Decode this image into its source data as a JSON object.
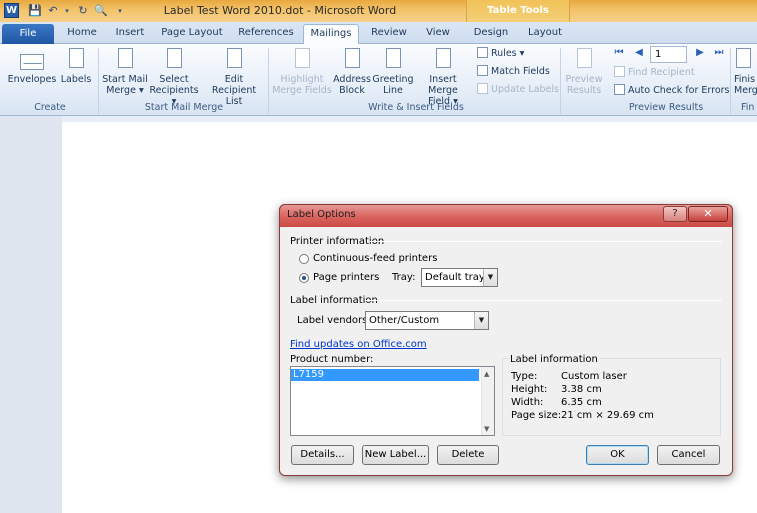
{
  "app": {
    "title": "Label Test Word 2010.dot  -  Microsoft Word",
    "logo_letter": "W",
    "context_tab_group": "Table Tools"
  },
  "tabs": [
    "File",
    "Home",
    "Insert",
    "Page Layout",
    "References",
    "Mailings",
    "Review",
    "View",
    "Design",
    "Layout"
  ],
  "ribbon": {
    "groups": {
      "create": "Create",
      "start_mail_merge": "Start Mail Merge",
      "write_insert": "Write & Insert Fields",
      "preview": "Preview Results",
      "finish": "Fin"
    },
    "buttons": {
      "envelopes": "Envelopes",
      "labels": "Labels",
      "start_mail_merge": [
        "Start Mail",
        "Merge ▾"
      ],
      "select_recipients": [
        "Select",
        "Recipients ▾"
      ],
      "edit_recipient_list": [
        "Edit",
        "Recipient List"
      ],
      "highlight_merge_fields": [
        "Highlight",
        "Merge Fields"
      ],
      "address_block": [
        "Address",
        "Block"
      ],
      "greeting_line": [
        "Greeting",
        "Line"
      ],
      "insert_merge_field": [
        "Insert Merge",
        "Field ▾"
      ],
      "rules": "Rules ▾",
      "match_fields": "Match Fields",
      "update_labels": "Update Labels",
      "preview_results": [
        "Preview",
        "Results"
      ],
      "find_recipient": "Find Recipient",
      "auto_check": "Auto Check for Errors",
      "finish": [
        "Finis",
        "Merg"
      ]
    },
    "record_number": "1"
  },
  "dialog": {
    "title": "Label Options",
    "help": "?",
    "close": "✕",
    "printer_info_label": "Printer information",
    "continuous_feed": "Continuous-feed printers",
    "page_printers": "Page printers",
    "tray_label": "Tray:",
    "tray_value": "Default tray",
    "label_info_label": "Label information",
    "vendors_label": "Label vendors:",
    "vendors_value": "Other/Custom",
    "find_updates_link": "Find updates on Office.com",
    "product_number_label": "Product number:",
    "products": [
      "L7159"
    ],
    "info_panel": {
      "heading": "Label information",
      "type_label": "Type:",
      "type_value": "Custom laser",
      "height_label": "Height:",
      "height_value": "3.38 cm",
      "width_label": "Width:",
      "width_value": "6.35 cm",
      "page_size_label": "Page size:",
      "page_size_value": "21 cm × 29.69 cm"
    },
    "buttons": {
      "details": "Details...",
      "new_label": "New Label...",
      "delete": "Delete",
      "ok": "OK",
      "cancel": "Cancel"
    }
  }
}
